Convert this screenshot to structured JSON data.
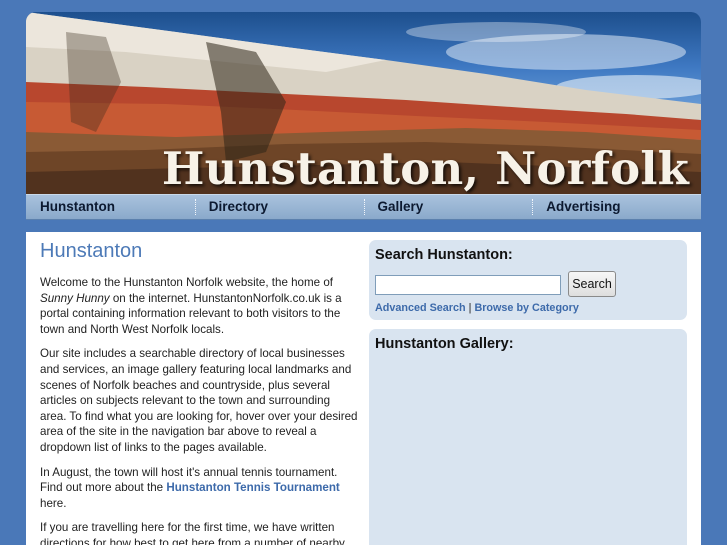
{
  "site": {
    "title": "Hunstanton, Norfolk"
  },
  "nav": {
    "items": [
      {
        "label": "Hunstanton"
      },
      {
        "label": "Directory"
      },
      {
        "label": "Gallery"
      },
      {
        "label": "Advertising"
      }
    ]
  },
  "main": {
    "heading": "Hunstanton",
    "p1": {
      "a": "Welcome to the Hunstanton Norfolk website, the home of ",
      "b": "Sunny Hunny",
      "c": " on the internet. HunstantonNorfolk.co.uk is a portal containing information relevant to both visitors to the town and North West Norfolk locals."
    },
    "p2": "Our site includes a searchable directory of local businesses and services, an image gallery featuring local landmarks and scenes of Norfolk beaches and countryside, plus several articles on subjects relevant to the town and surrounding area. To find what you are looking for, hover over your desired area of the site in the navigation bar above to reveal a dropdown list of links to the pages available.",
    "p3": {
      "a": "In August, the town will host it's annual tennis tournament. Find out more about the ",
      "link": "Hunstanton Tennis Tournament",
      "b": " here."
    },
    "p4": "If you are travelling here for the first time, we have written directions for how best to get here from a number of nearby"
  },
  "search": {
    "title": "Search Hunstanton:",
    "placeholder": "",
    "button_label": "Search",
    "advanced_link": "Advanced Search",
    "separator": "|",
    "category_link": "Browse by Category"
  },
  "gallery": {
    "title": "Hunstanton Gallery:"
  }
}
